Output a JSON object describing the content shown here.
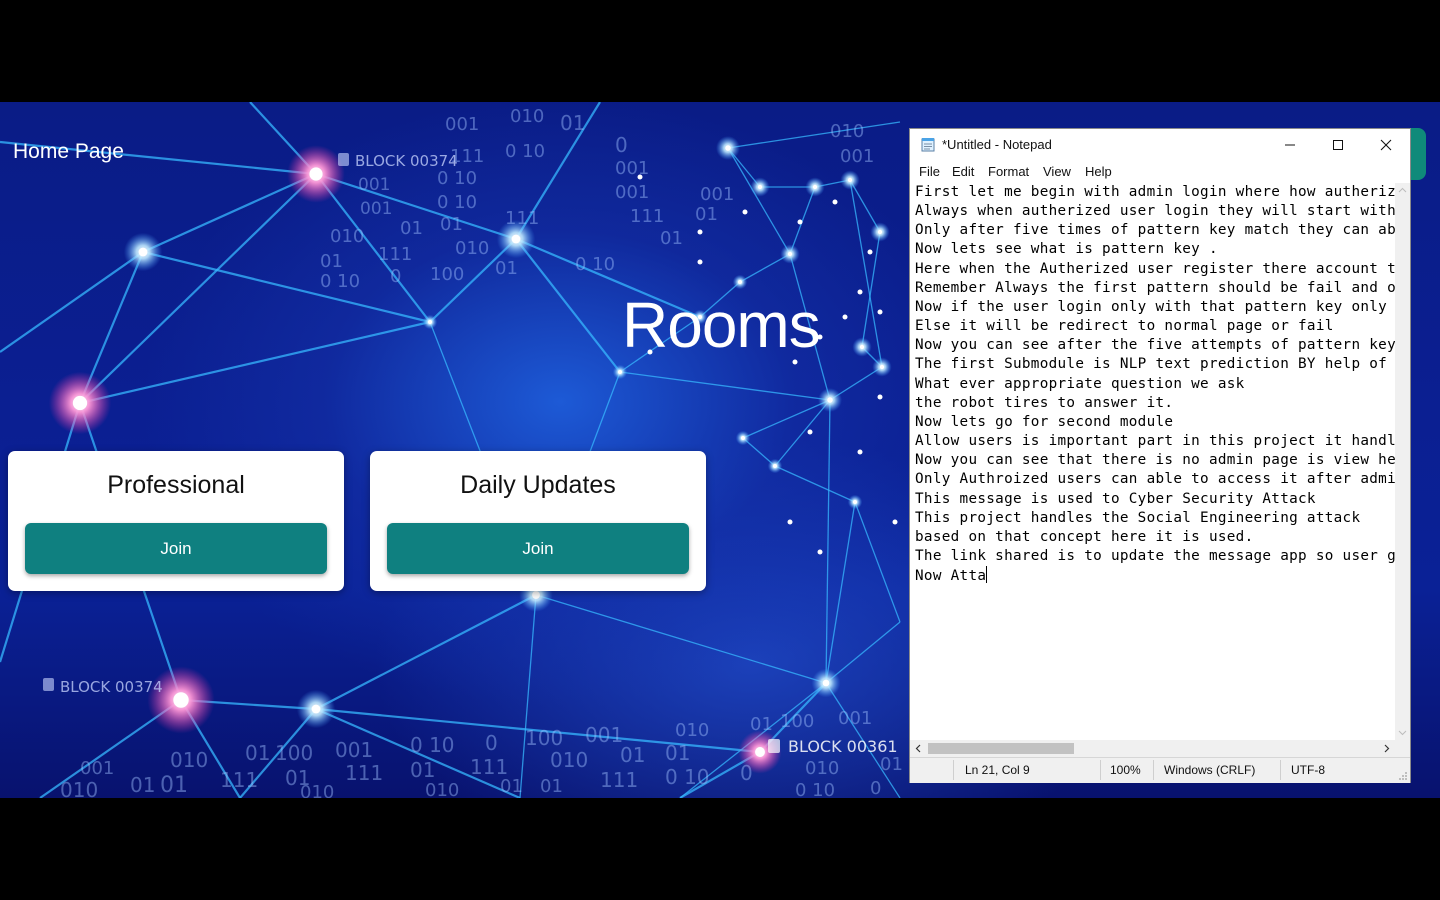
{
  "page": {
    "home_title": "Home Page",
    "rooms_title": "Rooms",
    "cards": [
      {
        "title": "Professional",
        "button": "Join"
      },
      {
        "title": "Daily Updates",
        "button": "Join"
      }
    ],
    "background_labels": [
      "BLOCK 00374",
      "BLOCK 00374",
      "BLOCK 00361"
    ],
    "colors": {
      "accent": "#0f8080",
      "background": "#0a1c86"
    }
  },
  "notepad": {
    "title": "*Untitled - Notepad",
    "menu": [
      "File",
      "Edit",
      "Format",
      "View",
      "Help"
    ],
    "lines": [
      "First let me begin with admin login where how autherized",
      "Always when autherized user login they will start with f",
      "Only after five times of pattern key match they can able",
      "Now lets see what is pattern key .",
      "Here when the Autherized user register there account the",
      "Remember Always the first pattern should be fail and oth",
      "Now if the user login only with that pattern key only th",
      "Else it will be redirect to normal page or fail",
      "Now you can see after the five attempts of pattern key c",
      "The first Submodule is NLP text prediction BY help of te",
      "What ever appropriate question we ask",
      "the robot tires to answer it.",
      "Now lets go for second module",
      "Allow users is important part in this project it handles",
      "Now you can see that there is no admin page is view here",
      "Only Authroized users can able to access it after admin",
      "This message is used to Cyber Security Attack",
      "This project handles the Social Engineering attack",
      "based on that concept here it is used.",
      "The link shared is to update the message app so user get",
      "Now Atta"
    ],
    "status": {
      "position": "Ln 21, Col 9",
      "zoom": "100%",
      "line_ending": "Windows (CRLF)",
      "encoding": "UTF-8"
    },
    "icons": [
      "notepad-app-icon",
      "minimize-icon",
      "maximize-icon",
      "close-icon"
    ]
  }
}
